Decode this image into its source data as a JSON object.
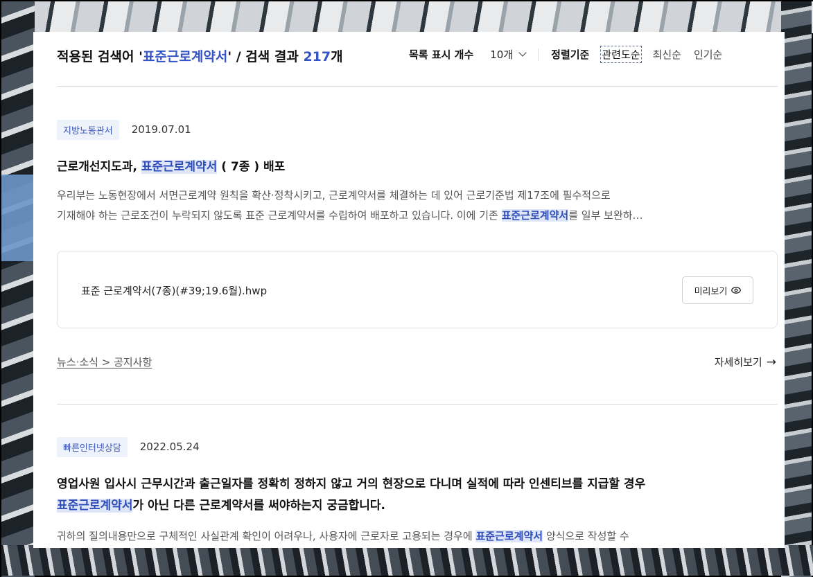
{
  "header": {
    "title_prefix": "적용된 검색어 '",
    "query": "표준근로계약서",
    "title_mid": "' / 검색 결과 ",
    "count": "217",
    "title_suffix": "개",
    "list_count_label": "목록 표시 개수",
    "list_count_value": "10개",
    "sort_label": "정렬기준",
    "sort_options": [
      "관련도순",
      "최신순",
      "인기순"
    ]
  },
  "results": [
    {
      "category": "지방노동관서",
      "date": "2019.07.01",
      "title_pre": "근로개선지도과, ",
      "title_hl": "표준근로계약서",
      "title_post": " ( 7종 ) 배포",
      "desc_line1": "우리부는 노동현장에서 서면근로계약 원칙을 확산·정착시키고, 근로계약서를 체결하는 데 있어 근로기준법 제17조에 필수적으로",
      "desc_line2_pre": "기재해야 하는 근로조건이 누락되지 않도록 표준 근로계약서를 수립하여 배포하고 있습니다. 이에 기존 ",
      "desc_line2_hl": "표준근로계약서",
      "desc_line2_post": "를 일부 보완하…",
      "attachment": "표준 근로계약서(7종)(#39;19.6월).hwp",
      "preview_label": "미리보기",
      "breadcrumb": "뉴스·소식 > 공지사항",
      "more_label": "자세히보기"
    },
    {
      "category": "빠른인터넷상담",
      "date": "2022.05.24",
      "title_line1": "영업사원 입사시 근무시간과 출근일자를 정확히 정하지 않고 거의 현장으로 다니며 실적에 따라 인센티브를 지급할 경우",
      "title_line2_hl": "표준근로계약서",
      "title_line2_post": "가 아닌 다른 근로계약서를 써야하는지 궁금합니다.",
      "desc_pre": "귀하의 질의내용만으로 구체적인 사실관계 확인이 어려우나, 사용자에 근로자로 고용되는 경우에 ",
      "desc_hl": "표준근로계약서",
      "desc_post": " 양식으로 작성할 수"
    }
  ]
}
